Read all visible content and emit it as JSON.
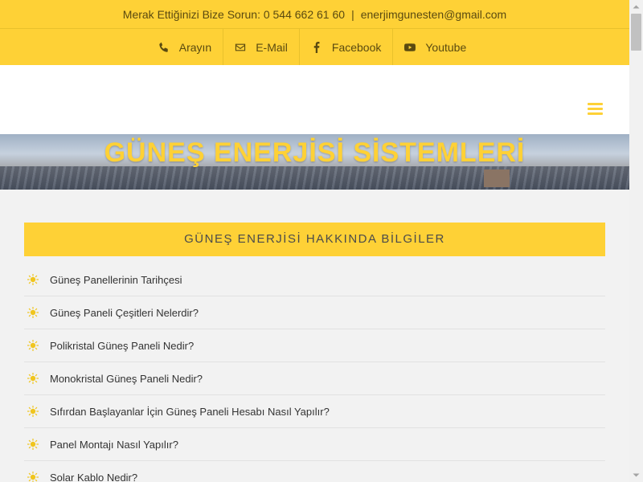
{
  "topbar": {
    "contact_text": "Merak Ettiğinizi Bize Sorun: 0 544 662 61 60",
    "separator": "|",
    "email": "enerjimgunesten@gmail.com"
  },
  "social": [
    {
      "label": "Arayın",
      "icon": "phone-icon"
    },
    {
      "label": "E-Mail",
      "icon": "envelope-icon"
    },
    {
      "label": "Facebook",
      "icon": "facebook-icon"
    },
    {
      "label": "Youtube",
      "icon": "youtube-icon"
    }
  ],
  "banner": {
    "title": "GÜNEŞ ENERJİSİ SİSTEMLERİ"
  },
  "section": {
    "heading": "GÜNEŞ ENERJİSİ HAKKINDA BİLGİLER"
  },
  "list": [
    "Güneş Panellerinin Tarihçesi",
    "Güneş Paneli Çeşitleri Nelerdir?",
    "Polikristal Güneş Paneli Nedir?",
    "Monokristal Güneş Paneli Nedir?",
    "Sıfırdan Başlayanlar İçin Güneş Paneli Hesabı Nasıl Yapılır?",
    "Panel Montajı Nasıl Yapılır?",
    "Solar Kablo Nedir?"
  ],
  "colors": {
    "accent": "#fed136",
    "text_dark": "#5a4a10",
    "list_icon": "#f0c51e"
  }
}
